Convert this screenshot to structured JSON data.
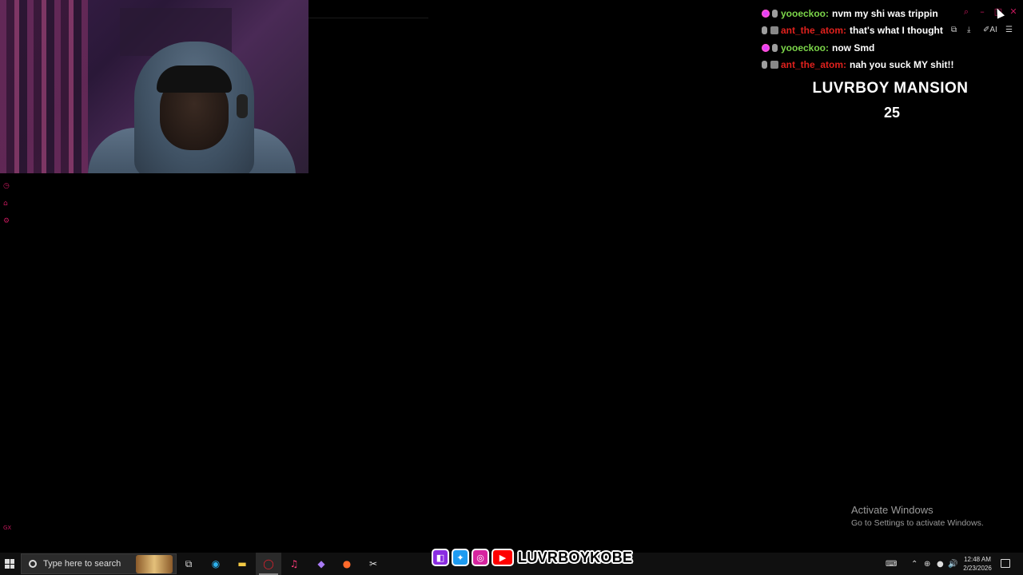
{
  "chat": [
    {
      "badges": [
        "sub-badge",
        "mic-badge"
      ],
      "username": "yooeckoo:",
      "user_color": "#7cd64a",
      "message": "nvm my shi was trippin"
    },
    {
      "badges": [
        "mic-badge",
        "mute-badge"
      ],
      "username": "ant_the_atom:",
      "user_color": "#e0211d",
      "message": "that's what I thought"
    },
    {
      "badges": [
        "sub-badge",
        "mic-badge"
      ],
      "username": "yooeckoo:",
      "user_color": "#7cd64a",
      "message": "now Smd"
    },
    {
      "badges": [
        "mic-badge",
        "mute-badge"
      ],
      "username": "ant_the_atom:",
      "user_color": "#e0211d",
      "message": "nah you suck MY shit!!"
    }
  ],
  "overlay": {
    "title": "LUVRBOY MANSION",
    "count": "25"
  },
  "browser_controls": {
    "ai_label": "AI"
  },
  "activation": {
    "title": "Activate Windows",
    "subtitle": "Go to Settings to activate Windows."
  },
  "socials": {
    "handle": "LUVRBOYKOBE",
    "icons": [
      "twitch-icon",
      "twitter-icon",
      "instagram-icon",
      "youtube-icon"
    ]
  },
  "taskbar": {
    "search_placeholder": "Type here to search",
    "time": "12:48 AM",
    "date": "2/23/2026",
    "apps": [
      "task-view-icon",
      "edge-icon",
      "file-explorer-icon",
      "opera-gx-icon",
      "itunes-icon",
      "obsidian-icon",
      "browser-icon",
      "snipping-tool-icon"
    ]
  },
  "colors": {
    "accent": "#c2185b",
    "green_user": "#7cd64a",
    "red_user": "#e0211d"
  },
  "side_label": "GX"
}
